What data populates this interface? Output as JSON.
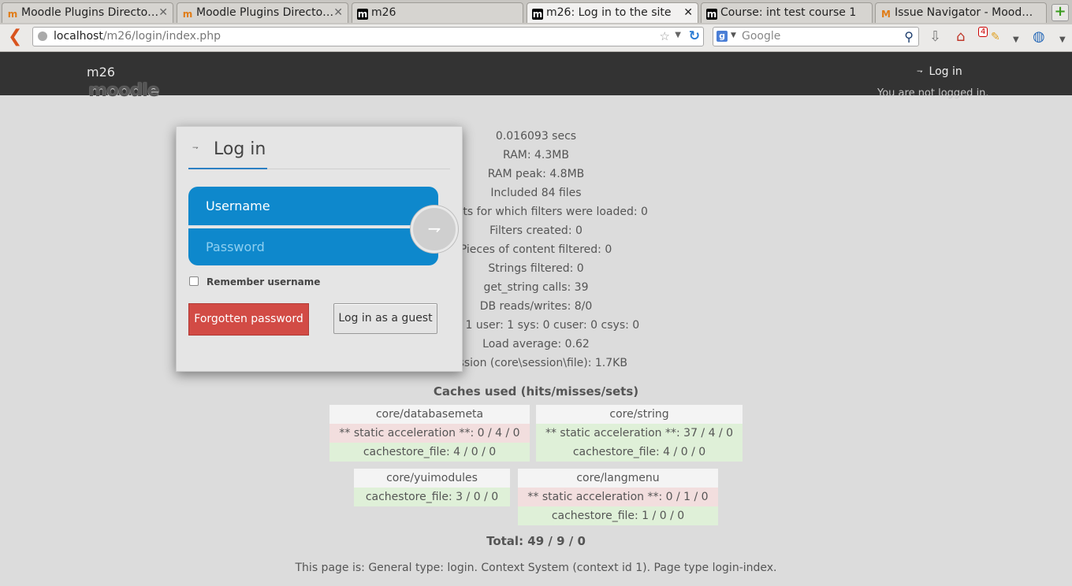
{
  "browser": {
    "tabs": [
      {
        "label": "Moodle Plugins Directo…",
        "icon": "m",
        "icon_color": "#e07c17",
        "active": false
      },
      {
        "label": "Moodle Plugins Directo…",
        "icon": "m",
        "icon_color": "#e07c17",
        "active": false
      },
      {
        "label": "m26",
        "icon": "m",
        "icon_color": "#000000",
        "active": false
      },
      {
        "label": "m26: Log in to the site",
        "icon": "m",
        "icon_color": "#000000",
        "active": true
      },
      {
        "label": "Course: int test course 1",
        "icon": "m",
        "icon_color": "#000000",
        "active": false
      },
      {
        "label": "Issue Navigator - Mood…",
        "icon": "M",
        "icon_color": "#e07c17",
        "active": false
      }
    ],
    "url_host": "localhost",
    "url_path": "/m26/login/index.php",
    "search_placeholder": "Google",
    "notification_count": "4"
  },
  "header": {
    "site_name": "m26",
    "logo": "moodle",
    "login_link": "Log in",
    "login_status": "You are not logged in."
  },
  "login": {
    "title": "Log in",
    "username_placeholder": "Username",
    "password_placeholder": "Password",
    "remember": "Remember username",
    "forgot_button": "Forgotten password",
    "guest_button": "Log in as a guest"
  },
  "perf": [
    "0.016093 secs",
    "RAM: 4.3MB",
    "RAM peak: 4.8MB",
    "Included 84 files",
    "Contexts for which filters were loaded: 0",
    "Filters created: 0",
    "Pieces of content filtered: 0",
    "Strings filtered: 0",
    "get_string calls: 39",
    "DB reads/writes: 8/0",
    "ticks: 1 user: 1 sys: 0 cuser: 0 csys: 0",
    "Load average: 0.62",
    "Session (core\\session\\file): 1.7KB"
  ],
  "caches": {
    "title": "Caches used (hits/misses/sets)",
    "items": [
      {
        "name": "core/databasemeta",
        "rows": [
          "** static acceleration **: 0 / 4 / 0",
          "cachestore_file: 4 / 0 / 0"
        ]
      },
      {
        "name": "core/string",
        "rows": [
          "** static acceleration **: 37 / 4 / 0",
          "cachestore_file: 4 / 0 / 0"
        ]
      },
      {
        "name": "core/yuimodules",
        "rows": [
          "cachestore_file: 3 / 0 / 0"
        ]
      },
      {
        "name": "core/langmenu",
        "rows": [
          "** static acceleration **: 0 / 1 / 0",
          "cachestore_file: 1 / 0 / 0"
        ]
      }
    ],
    "total": "Total: 49 / 9 / 0"
  },
  "page_info": "This page is: General type: login. Context System (context id 1). Page type login-index.",
  "colors": {
    "header_bg": "#333333",
    "field_blue": "#0e88cc",
    "forgot_red": "#d24b45",
    "hit_green": "#dff0d8",
    "miss_red": "#f2dede"
  }
}
